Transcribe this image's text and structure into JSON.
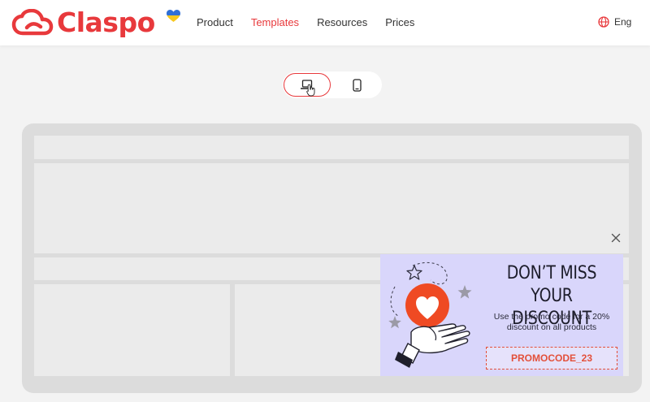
{
  "brand": {
    "name": "Claspo",
    "accent": "#e8393c"
  },
  "nav": {
    "items": [
      {
        "label": "Product",
        "active": false
      },
      {
        "label": "Templates",
        "active": true
      },
      {
        "label": "Resources",
        "active": false
      },
      {
        "label": "Prices",
        "active": false
      }
    ],
    "language": "Eng"
  },
  "device_toggle": {
    "options": [
      "desktop",
      "mobile"
    ],
    "selected": "desktop"
  },
  "popup": {
    "title_line1": "DON’T MISS YOUR",
    "title_line2": "DISCOUNT",
    "desc_line1": "Use the promo code for a 20%",
    "desc_line2": "discount on all products",
    "promo_code": "PROMOCODE_23",
    "background": "#d9d6fb",
    "accent": "#e3503a"
  }
}
